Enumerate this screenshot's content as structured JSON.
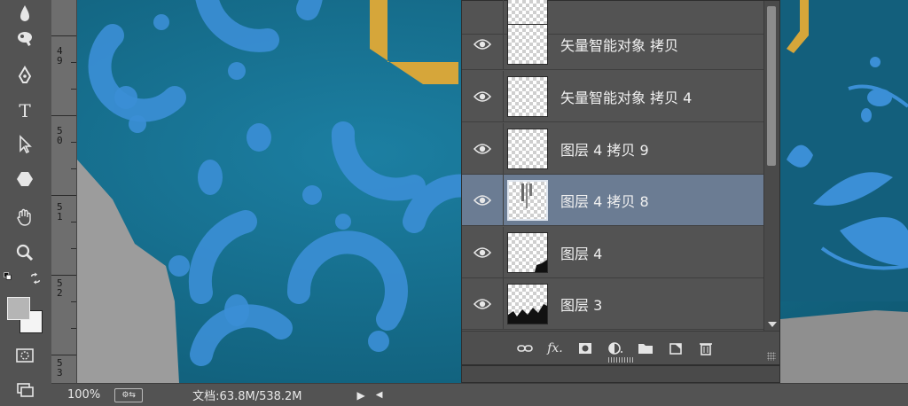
{
  "statusbar": {
    "zoom": "100%",
    "doc_info": "文档:63.8M/538.2M"
  },
  "ruler": {
    "labels": [
      {
        "digits": [
          "4",
          "9"
        ]
      },
      {
        "digits": [
          "5",
          "0"
        ]
      },
      {
        "digits": [
          "5",
          "1"
        ]
      },
      {
        "digits": [
          "5",
          "2"
        ]
      },
      {
        "digits": [
          "5",
          "3"
        ]
      }
    ]
  },
  "layers": {
    "rows": [
      {
        "name": "矢量智能对象 拷贝",
        "selected": false
      },
      {
        "name": "矢量智能对象 拷贝 4",
        "selected": false
      },
      {
        "name": "图层 4 拷贝 9",
        "selected": false
      },
      {
        "name": "图层 4 拷贝 8",
        "selected": true
      },
      {
        "name": "图层 4",
        "selected": false
      },
      {
        "name": "图层 3",
        "selected": false
      }
    ]
  },
  "tools": [
    "blur-tool",
    "dodge-tool",
    "pen-tool",
    "type-tool",
    "path-selection-tool",
    "shape-tool",
    "hand-tool",
    "zoom-tool"
  ],
  "colors": {
    "canvas_teal": "#146985",
    "pattern_blue": "#3b8fd6",
    "gold": "#d6a63a",
    "selected_row": "#6b7c93"
  }
}
